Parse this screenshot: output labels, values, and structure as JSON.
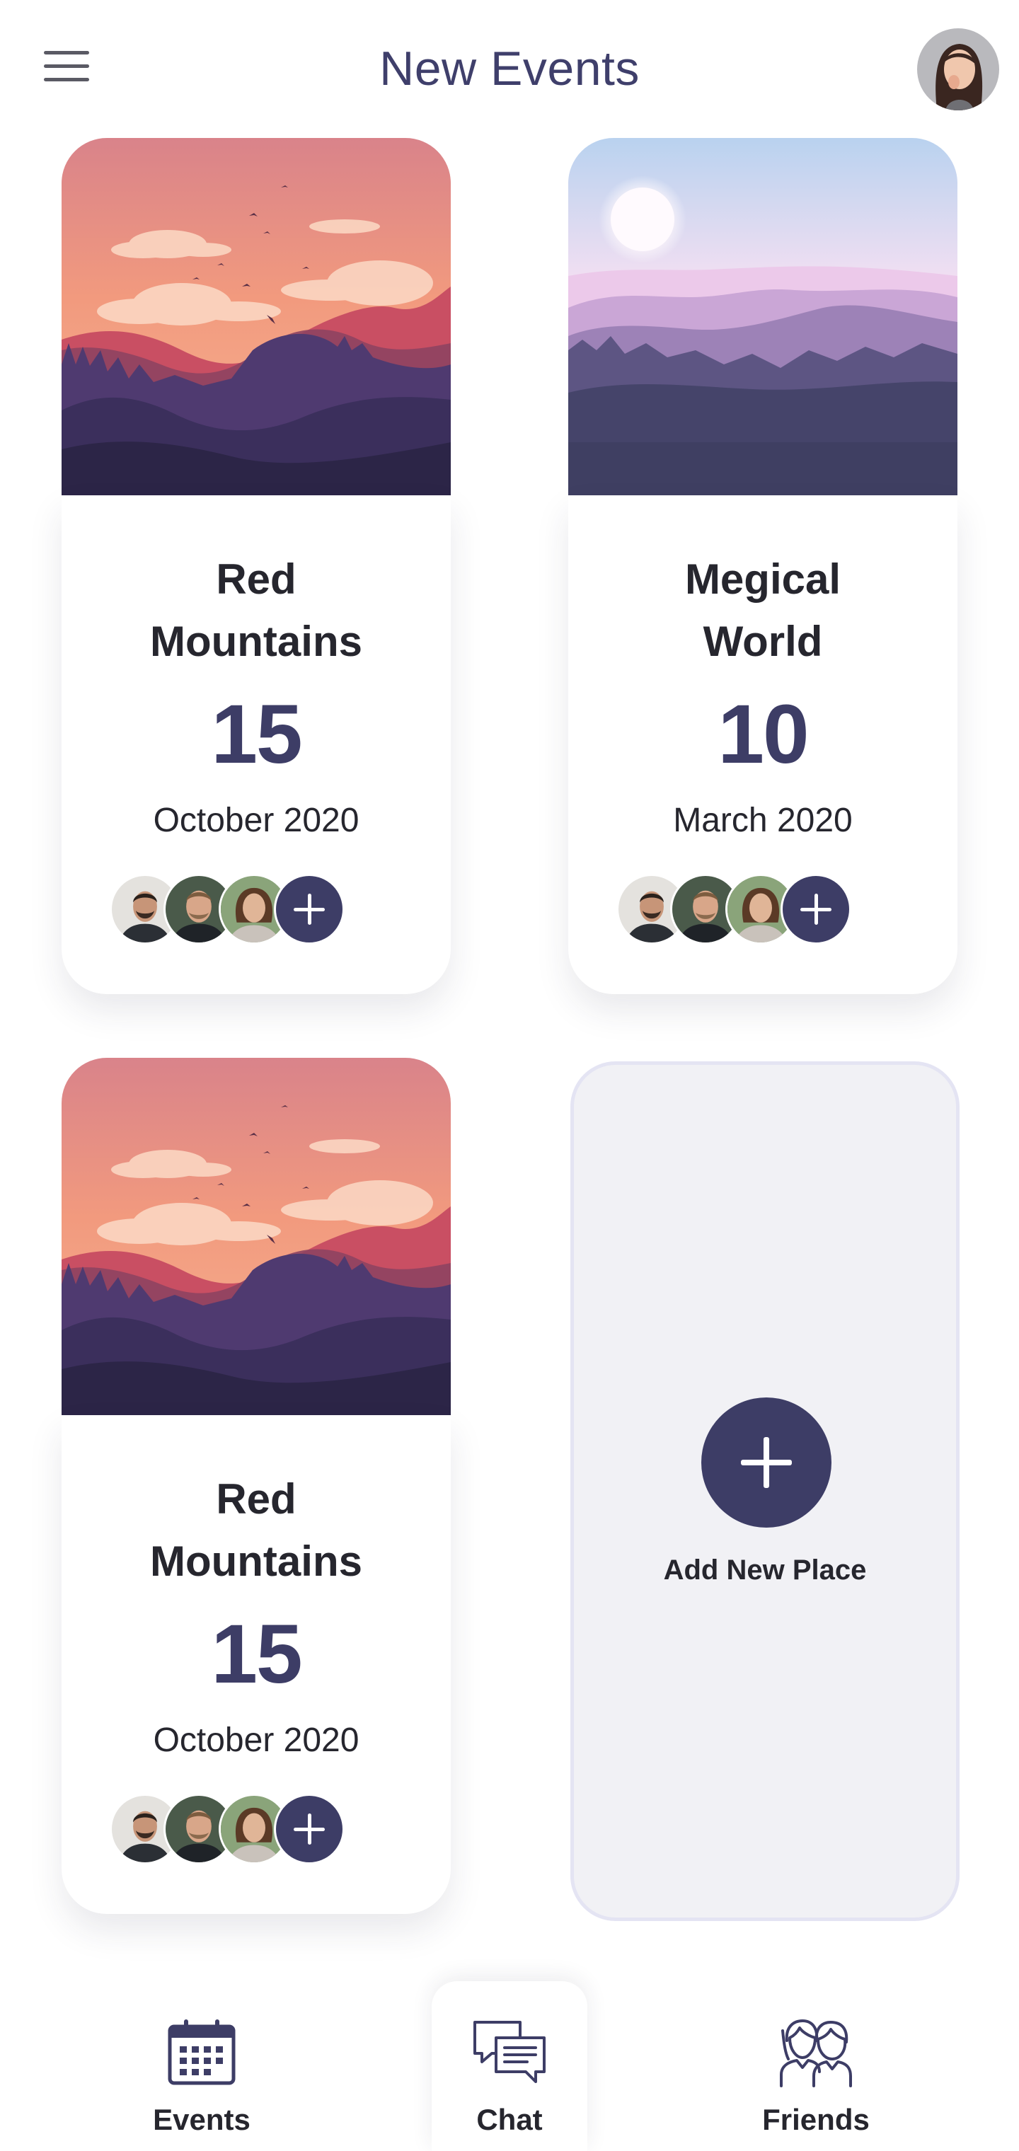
{
  "header": {
    "title": "New Events",
    "menu_icon": "hamburger-menu-icon",
    "profile_avatar": "user-avatar"
  },
  "events": [
    {
      "title_line1": "Red",
      "title_line2": "Mountains",
      "day": "15",
      "month_year": "October 2020",
      "image": "sunset-mountains-illustration"
    },
    {
      "title_line1": "Megical",
      "title_line2": "World",
      "day": "10",
      "month_year": "March 2020",
      "image": "misty-purple-mountains-illustration"
    },
    {
      "title_line1": "Red",
      "title_line2": "Mountains",
      "day": "15",
      "month_year": "October 2020",
      "image": "sunset-mountains-illustration"
    }
  ],
  "add_place": {
    "label": "Add New Place",
    "icon": "plus-icon"
  },
  "bottom_nav": [
    {
      "label": "Events",
      "icon": "calendar-icon"
    },
    {
      "label": "Chat",
      "icon": "chat-bubbles-icon"
    },
    {
      "label": "Friends",
      "icon": "friends-icon"
    }
  ],
  "colors": {
    "accent": "#3d3d66",
    "title": "#3f3f6b",
    "text": "#26262e",
    "add_card_bg": "#f1f1f5",
    "add_card_border": "#e4e4f3"
  }
}
